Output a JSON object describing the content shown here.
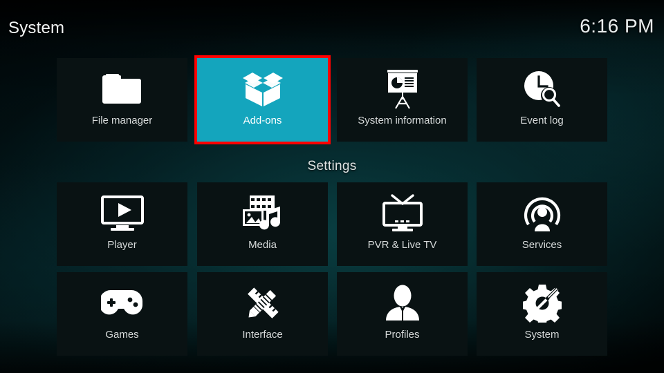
{
  "header": {
    "title": "System",
    "clock": "6:16 PM"
  },
  "colors": {
    "selected_tile": "#14a5bd",
    "highlight_border": "#ff0000",
    "tile_background": "#091213",
    "label_text": "#d6dada"
  },
  "top_row": {
    "items": [
      {
        "label": "File manager",
        "icon": "folder-icon",
        "selected": false
      },
      {
        "label": "Add-ons",
        "icon": "open-box-icon",
        "selected": true
      },
      {
        "label": "System information",
        "icon": "presentation-chart-icon",
        "selected": false
      },
      {
        "label": "Event log",
        "icon": "clock-search-icon",
        "selected": false
      }
    ]
  },
  "settings_section": {
    "label": "Settings",
    "items": [
      {
        "label": "Player",
        "icon": "monitor-play-icon",
        "selected": false
      },
      {
        "label": "Media",
        "icon": "film-picture-music-icon",
        "selected": false
      },
      {
        "label": "PVR & Live TV",
        "icon": "tv-antenna-icon",
        "selected": false
      },
      {
        "label": "Services",
        "icon": "person-broadcast-icon",
        "selected": false
      },
      {
        "label": "Games",
        "icon": "gamepad-icon",
        "selected": false
      },
      {
        "label": "Interface",
        "icon": "pencil-ruler-icon",
        "selected": false
      },
      {
        "label": "Profiles",
        "icon": "person-icon",
        "selected": false
      },
      {
        "label": "System",
        "icon": "gear-screwdriver-icon",
        "selected": false
      }
    ]
  }
}
